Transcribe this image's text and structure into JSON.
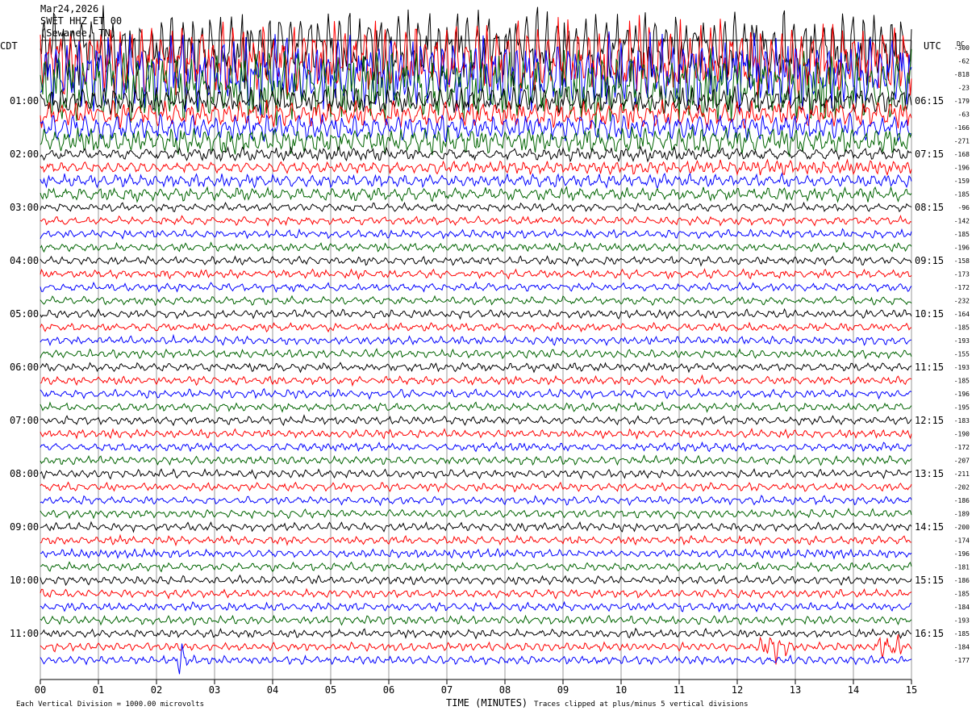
{
  "header": {
    "date": "Mar24,2026",
    "station": "SWET HHZ ET 00",
    "location": "(Sewanee, TN)"
  },
  "left_axis_label": "CDT",
  "right_axis_label": "UTC",
  "dc_label": "DC",
  "footer": {
    "scale_note": "Each Vertical Division = 1000.00 microvolts",
    "x_axis_title": "TIME (MINUTES)",
    "clip_note": "Traces clipped at plus/minus 5 vertical divisions"
  },
  "chart_data": {
    "type": "line",
    "title": "",
    "xlabel": "TIME (MINUTES)",
    "xlim": [
      0,
      15
    ],
    "x_ticks": [
      "00",
      "01",
      "02",
      "03",
      "04",
      "05",
      "06",
      "07",
      "08",
      "09",
      "10",
      "11",
      "12",
      "13",
      "14",
      "15"
    ],
    "left_time_labels": [
      "01:00",
      "02:00",
      "03:00",
      "04:00",
      "05:00",
      "06:00",
      "07:00",
      "08:00",
      "09:00",
      "10:00",
      "11:00"
    ],
    "right_time_labels": [
      "06:15",
      "07:15",
      "08:15",
      "09:15",
      "10:15",
      "11:15",
      "12:15",
      "13:15",
      "14:15",
      "15:15",
      "16:15"
    ],
    "trace_colors": [
      "#000000",
      "#ff0000",
      "#0000ff",
      "#006400"
    ],
    "dc_offsets": [
      "-300",
      "-62",
      "-818",
      "-23",
      "-179",
      "-63",
      "-166",
      "-271",
      "-168",
      "-196",
      "-159",
      "-185",
      "-96",
      "-142",
      "-185",
      "-196",
      "-158",
      "-173",
      "-172",
      "-232",
      "-164",
      "-185",
      "-193",
      "-155",
      "-193",
      "-185",
      "-196",
      "-195",
      "-183",
      "-190",
      "-172",
      "-207",
      "-211",
      "-202",
      "-186",
      "-189",
      "-200",
      "-174",
      "-196",
      "-181",
      "-186",
      "-185",
      "-184",
      "-193",
      "-185",
      "-184",
      "-177"
    ],
    "events": [
      {
        "trace": 46,
        "minute_start": 2.3,
        "minute_end": 2.6
      },
      {
        "trace": 45,
        "minute_start": 12.3,
        "minute_end": 13.0
      },
      {
        "trace": 45,
        "minute_start": 14.3,
        "minute_end": 14.9
      }
    ]
  }
}
